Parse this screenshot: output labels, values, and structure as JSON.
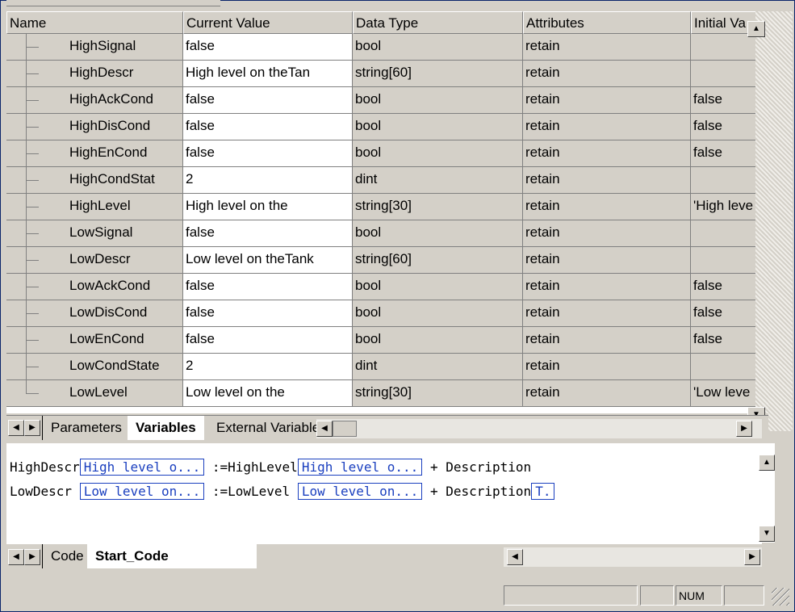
{
  "table": {
    "columns": [
      "Name",
      "Current Value",
      "Data Type",
      "Attributes",
      "Initial Va"
    ],
    "rows": [
      {
        "name": "HighSignal",
        "value": "false",
        "type": "bool",
        "attr": "retain",
        "init": ""
      },
      {
        "name": "HighDescr",
        "value": "High level on theTan",
        "type": "string[60]",
        "attr": "retain",
        "init": ""
      },
      {
        "name": "HighAckCond",
        "value": "false",
        "type": "bool",
        "attr": "retain",
        "init": "false"
      },
      {
        "name": "HighDisCond",
        "value": "false",
        "type": "bool",
        "attr": "retain",
        "init": "false"
      },
      {
        "name": "HighEnCond",
        "value": "false",
        "type": "bool",
        "attr": "retain",
        "init": "false"
      },
      {
        "name": "HighCondStat",
        "value": "2",
        "type": "dint",
        "attr": "retain",
        "init": ""
      },
      {
        "name": "HighLevel",
        "value": "High level on the",
        "type": "string[30]",
        "attr": "retain",
        "init": "'High leve"
      },
      {
        "name": "LowSignal",
        "value": "false",
        "type": "bool",
        "attr": "retain",
        "init": ""
      },
      {
        "name": "LowDescr",
        "value": "Low level on theTank",
        "type": "string[60]",
        "attr": "retain",
        "init": ""
      },
      {
        "name": "LowAckCond",
        "value": "false",
        "type": "bool",
        "attr": "retain",
        "init": "false"
      },
      {
        "name": "LowDisCond",
        "value": "false",
        "type": "bool",
        "attr": "retain",
        "init": "false"
      },
      {
        "name": "LowEnCond",
        "value": "false",
        "type": "bool",
        "attr": "retain",
        "init": "false"
      },
      {
        "name": "LowCondState",
        "value": "2",
        "type": "dint",
        "attr": "retain",
        "init": ""
      },
      {
        "name": "LowLevel",
        "value": "Low level on the",
        "type": "string[30]",
        "attr": "retain",
        "init": "'Low leve"
      }
    ]
  },
  "top_tabs": [
    "Parameters",
    "Variables",
    "External Variables"
  ],
  "top_tabs_active": "Variables",
  "code": {
    "line1": {
      "lhs": "HighDescr",
      "lhs_val": "High level o...",
      "op": ":=",
      "rhs": "HighLevel",
      "rhs_val": "High level o...",
      "tail": "+ Description"
    },
    "line2": {
      "lhs": "LowDescr",
      "lhs_val": "Low level on...",
      "op": ":=",
      "rhs": "LowLevel",
      "rhs_val": "Low level on...",
      "tail": "+ Description",
      "tail_box": "T."
    }
  },
  "bottom_tabs": [
    "Code",
    "Start_Code"
  ],
  "bottom_tabs_active": "Start_Code",
  "status": {
    "num": "NUM"
  },
  "icons": {
    "up": "▲",
    "down": "▼",
    "left": "◀",
    "right": "▶"
  }
}
